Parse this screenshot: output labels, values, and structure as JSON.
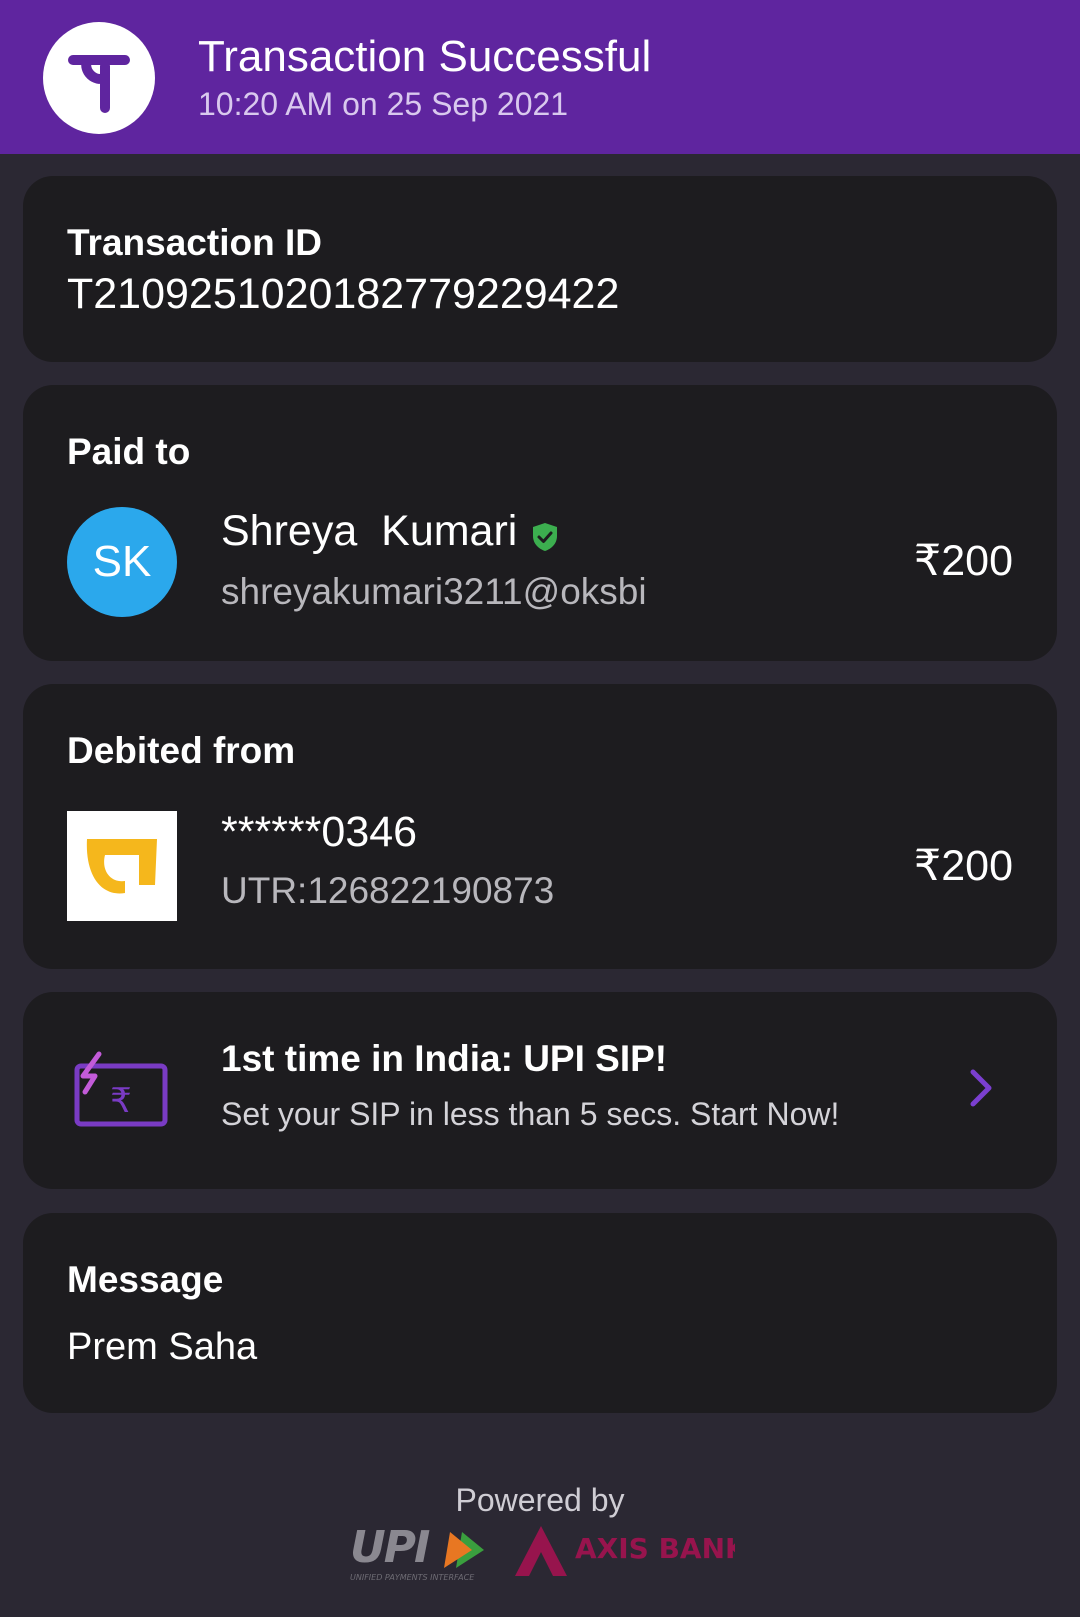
{
  "header": {
    "title": "Transaction Successful",
    "datetime": "10:20 AM on 25 Sep 2021",
    "brand_color": "#5f259f",
    "logo_icon": "phonepe-logo-icon"
  },
  "transaction": {
    "label": "Transaction ID",
    "id": "T2109251020182779229422"
  },
  "paid_to": {
    "label": "Paid to",
    "avatar_initials": "SK",
    "name": "Shreya  Kumari",
    "upi_id": "shreyakumari3211@oksbi",
    "amount": "₹200",
    "verified_icon": "verified-shield-icon"
  },
  "debited_from": {
    "label": "Debited from",
    "account": "******0346",
    "utr": "UTR:126822190873",
    "amount": "₹200",
    "bank_icon": "pnb-bank-logo-icon"
  },
  "promo": {
    "title": "1st time in India: UPI SIP!",
    "subtitle": "Set your SIP in less than 5 secs. Start Now!",
    "icon": "sip-rupee-card-icon"
  },
  "message": {
    "label": "Message",
    "text": "Prem Saha"
  },
  "footer": {
    "powered_by": "Powered by",
    "upi_logo_text": "UPI",
    "upi_tagline": "UNIFIED PAYMENTS INTERFACE",
    "bank_name": "AXIS BANK"
  }
}
